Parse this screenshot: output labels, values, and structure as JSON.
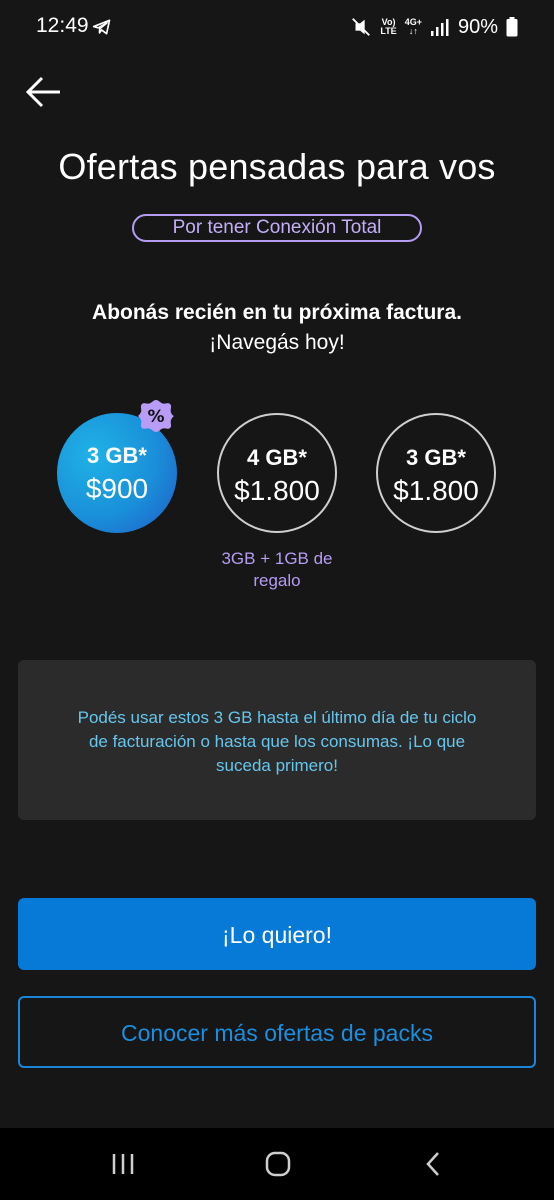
{
  "status_bar": {
    "time": "12:49",
    "network_top": "Vo)",
    "network_bottom": "LTE",
    "data_top": "4G+",
    "battery": "90%"
  },
  "header": {
    "title": "Ofertas pensadas para vos",
    "badge": "Por tener Conexión Total"
  },
  "subtitle": {
    "line1": "Abonás recién en tu próxima factura.",
    "line2": "¡Navegás hoy!"
  },
  "packs": [
    {
      "gb": "3 GB*",
      "price": "$900",
      "selected": true,
      "discount": "%"
    },
    {
      "gb": "4 GB*",
      "price": "$1.800",
      "selected": false,
      "note": "3GB + 1GB de regalo"
    },
    {
      "gb": "3 GB*",
      "price": "$1.800",
      "selected": false
    }
  ],
  "info": {
    "text": "Podés usar estos 3 GB hasta el último día de tu ciclo de facturación o hasta que los consumas. ¡Lo que suceda primero!"
  },
  "actions": {
    "primary_label": "¡Lo quiero!",
    "secondary_label": "Conocer más ofertas de packs"
  },
  "icons": {
    "back": "arrow-left-icon",
    "telegram": "telegram-icon",
    "mute": "vibrate-mute-icon",
    "signal": "signal-icon",
    "battery": "battery-icon",
    "discount": "discount-percent-icon",
    "nav_recents": "recents-icon",
    "nav_home": "home-icon",
    "nav_back": "nav-back-icon"
  },
  "colors": {
    "background": "#161616",
    "accent_blue": "#0779d6",
    "accent_purple": "#b59cf2",
    "info_text": "#66c6ee",
    "info_box": "#2b2b2b"
  }
}
